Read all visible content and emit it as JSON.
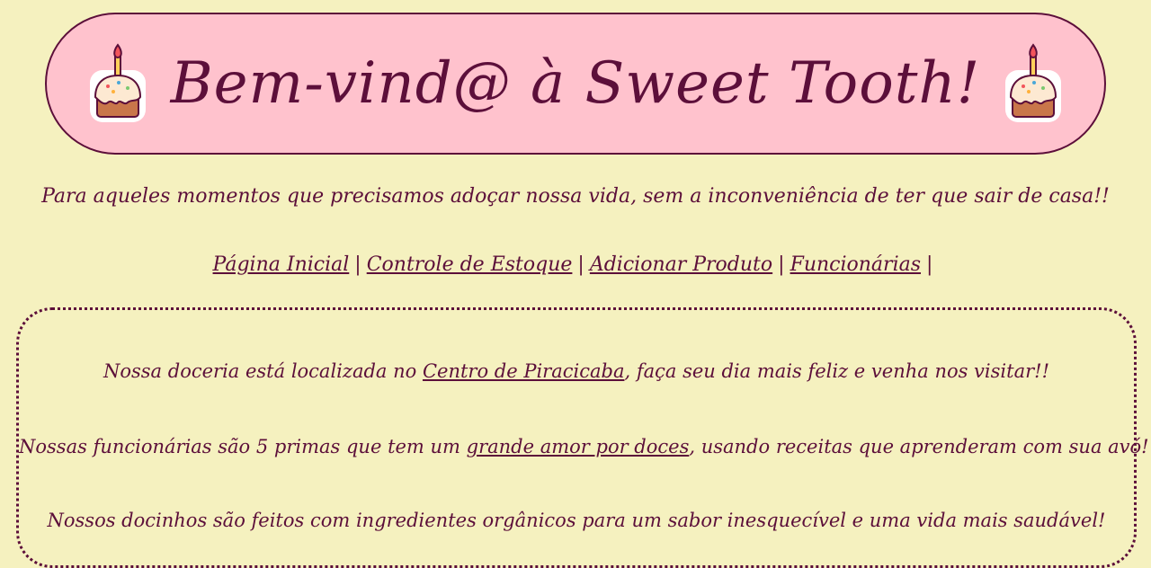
{
  "header": {
    "title": "Bem-vind@ à Sweet Tooth!",
    "left_icon": "cake-icon",
    "right_icon": "cake-icon"
  },
  "tagline": "Para aqueles momentos que precisamos adoçar nossa vida, sem a inconveniência de ter que sair de casa!!",
  "nav": {
    "items": [
      {
        "label": "Página Inicial"
      },
      {
        "label": "Controle de Estoque"
      },
      {
        "label": "Adicionar Produto"
      },
      {
        "label": "Funcionárias"
      }
    ],
    "separator": "|"
  },
  "content": {
    "p1": {
      "before": "Nossa doceria está localizada no ",
      "link": "Centro de Piracicaba",
      "after": ", faça seu dia mais feliz e venha nos visitar!!"
    },
    "p2": {
      "before": "Nossas funcionárias são 5 primas que tem um ",
      "link": "grande amor por doces",
      "after": ", usando receitas que aprenderam com sua avó!"
    },
    "p3": {
      "text": "Nossos docinhos são feitos com ingredientes orgânicos para um sabor inesquecível e uma vida mais saudável!"
    }
  },
  "colors": {
    "background": "#f5f1bf",
    "banner": "#ffc2cd",
    "accent": "#5c0f3a"
  }
}
